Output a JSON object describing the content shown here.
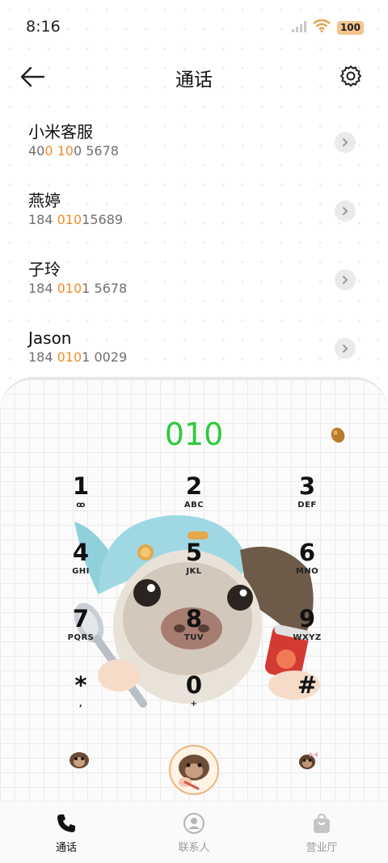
{
  "status_bar": {
    "time": "8:16",
    "battery": "100"
  },
  "header": {
    "title": "通话"
  },
  "recent_calls": [
    {
      "name": "小米客服",
      "number_parts": [
        "40",
        "0 10",
        "0 5678"
      ]
    },
    {
      "name": "燕婷",
      "number_parts": [
        "184 ",
        "010",
        "15689"
      ]
    },
    {
      "name": "子玲",
      "number_parts": [
        "184 ",
        "010",
        "1 5678"
      ]
    },
    {
      "name": "Jason",
      "number_parts": [
        "184 ",
        "010",
        "1 0029"
      ]
    }
  ],
  "dialer": {
    "input": "010",
    "keys": [
      {
        "digit": "1",
        "letters": "ꝏ"
      },
      {
        "digit": "2",
        "letters": "ABC"
      },
      {
        "digit": "3",
        "letters": "DEF"
      },
      {
        "digit": "4",
        "letters": "GHI"
      },
      {
        "digit": "5",
        "letters": "JKL"
      },
      {
        "digit": "6",
        "letters": "MNO"
      },
      {
        "digit": "7",
        "letters": "PQRS"
      },
      {
        "digit": "8",
        "letters": "TUV"
      },
      {
        "digit": "9",
        "letters": "WXYZ"
      },
      {
        "digit": "*",
        "letters": ","
      },
      {
        "digit": "0",
        "letters": "+"
      },
      {
        "digit": "#",
        "letters": ""
      }
    ]
  },
  "tabs": [
    {
      "label": "通话",
      "icon": "phone-icon",
      "active": true
    },
    {
      "label": "联系人",
      "icon": "contacts-icon",
      "active": false
    },
    {
      "label": "营业厅",
      "icon": "store-bag-icon",
      "active": false
    }
  ],
  "colors": {
    "accent_green": "#2ec93c",
    "highlight_orange": "#f08d2a"
  }
}
